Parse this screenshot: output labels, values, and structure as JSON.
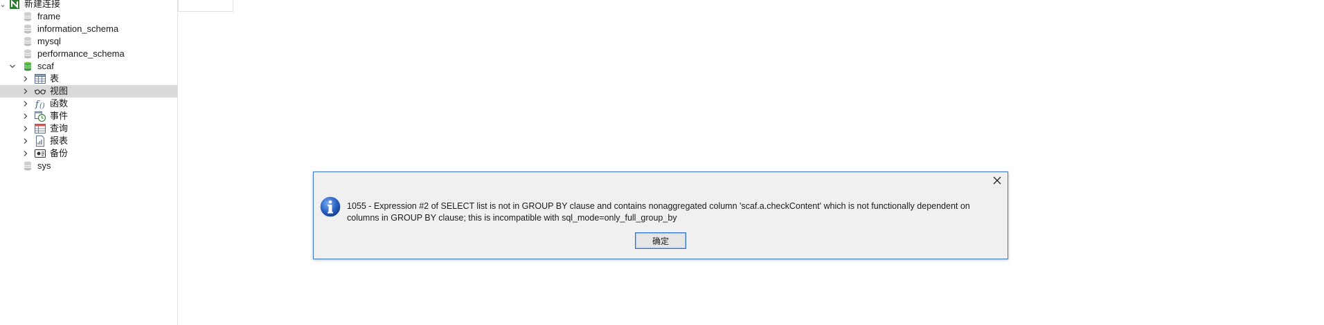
{
  "sidebar": {
    "connection": {
      "label": "新建连接"
    },
    "databases": [
      {
        "label": "frame"
      },
      {
        "label": "information_schema"
      },
      {
        "label": "mysql"
      },
      {
        "label": "performance_schema"
      },
      {
        "label": "scaf"
      }
    ],
    "scaf_children": [
      {
        "label": "表",
        "icon": "table-icon"
      },
      {
        "label": "视图",
        "icon": "view-glasses-icon"
      },
      {
        "label": "函数",
        "icon": "function-icon"
      },
      {
        "label": "事件",
        "icon": "event-clock-icon"
      },
      {
        "label": "查询",
        "icon": "query-icon"
      },
      {
        "label": "报表",
        "icon": "report-icon"
      },
      {
        "label": "备份",
        "icon": "backup-icon"
      }
    ],
    "tail_databases": [
      {
        "label": "sys"
      }
    ],
    "selected_item": "视图"
  },
  "dialog": {
    "message_line1": "1055 - Expression #2 of SELECT list is not in GROUP BY clause and contains nonaggregated column 'scaf.a.checkContent' which is not functionally dependent on",
    "message_line2": "columns in GROUP BY clause; this is incompatible with sql_mode=only_full_group_by",
    "ok_label": "确定",
    "icon": "info-icon",
    "close_icon": "close-icon"
  },
  "colors": {
    "accent": "#3b78c6",
    "db_active": "#4caf50",
    "selected_row": "#d9d9d9"
  }
}
